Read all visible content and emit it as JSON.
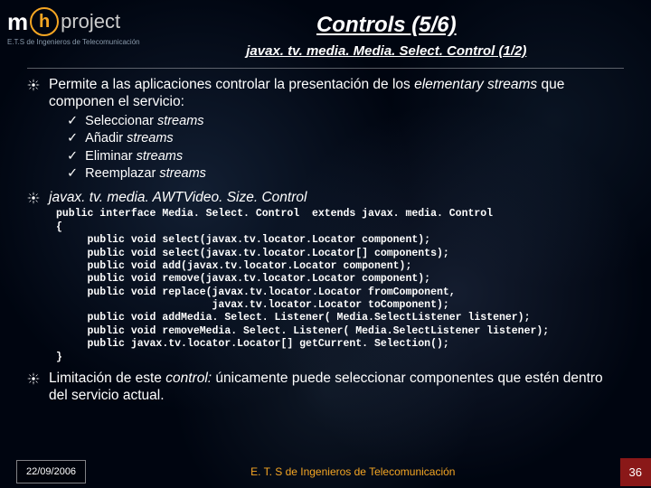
{
  "header": {
    "logo_m": "m",
    "logo_h": "h",
    "logo_p": "project",
    "logo_sub": "E.T.S de Ingenieros de Telecomunicación",
    "title": "Controls (5/6)",
    "subtitle": "javax. tv. media. Media. Select. Control (1/2)"
  },
  "bullets": {
    "b1_a": "Permite a las aplicaciones controlar la presentación de los ",
    "b1_b": "elementary streams",
    "b1_c": " que componen el servicio:",
    "sub1_a": "Seleccionar ",
    "sub1_b": "streams",
    "sub2_a": "Añadir ",
    "sub2_b": "streams",
    "sub3_a": "Eliminar ",
    "sub3_b": "streams",
    "sub4_a": "Reemplazar ",
    "sub4_b": "streams",
    "b2": "javax. tv. media. AWTVideo. Size. Control",
    "b3_a": "Limitación de este ",
    "b3_b": "control:",
    "b3_c": " únicamente puede seleccionar componentes que estén dentro del servicio actual."
  },
  "code": "public interface Media. Select. Control  extends javax. media. Control\n{\n     public void select(javax.tv.locator.Locator component);\n     public void select(javax.tv.locator.Locator[] components);\n     public void add(javax.tv.locator.Locator component);\n     public void remove(javax.tv.locator.Locator component);\n     public void replace(javax.tv.locator.Locator fromComponent,\n                         javax.tv.locator.Locator toComponent);\n     public void addMedia. Select. Listener( Media.SelectListener listener);\n     public void removeMedia. Select. Listener( Media.SelectListener listener);\n     public javax.tv.locator.Locator[] getCurrent. Selection();\n}",
  "footer": {
    "date": "22/09/2006",
    "center": "E. T. S de Ingenieros de Telecomunicación",
    "page": "36"
  }
}
